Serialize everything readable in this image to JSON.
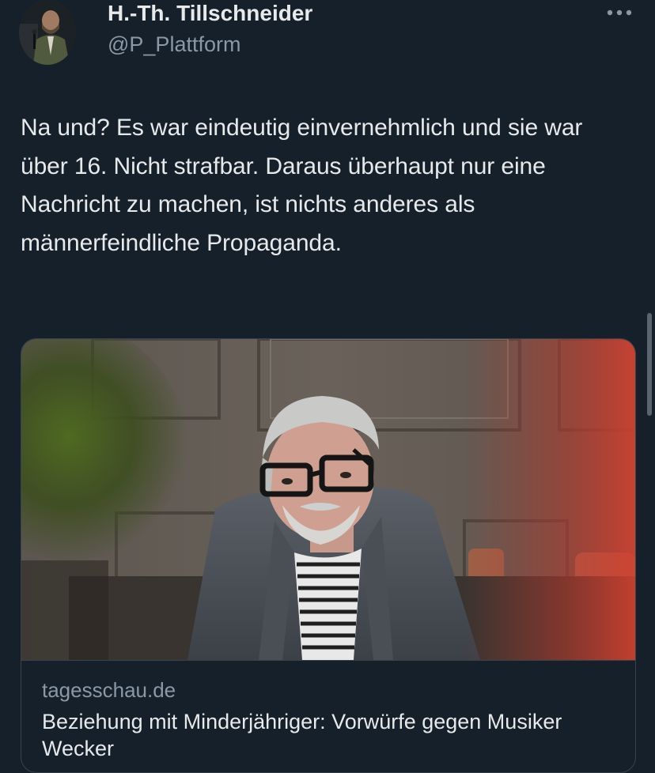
{
  "tweet": {
    "author_name": "H.-Th. Tillschneider",
    "author_handle": "@P_Plattform",
    "text": "Na und? Es war eindeutig einvernehmlich und sie war über 16. Nicht strafbar. Daraus überhaupt nur eine Nachricht zu machen, ist nichts anderes als männerfeindliche Propaganda."
  },
  "link_card": {
    "domain": "tagesschau.de",
    "title": "Beziehung mit Minderjähriger: Vorwürfe gegen Musiker Wecker"
  },
  "icons": {
    "more": "more-horizontal-icon"
  },
  "colors": {
    "background": "#15202b",
    "primary_text": "#e7e9ea",
    "secondary_text": "#8b98a5",
    "border": "#38444d"
  }
}
